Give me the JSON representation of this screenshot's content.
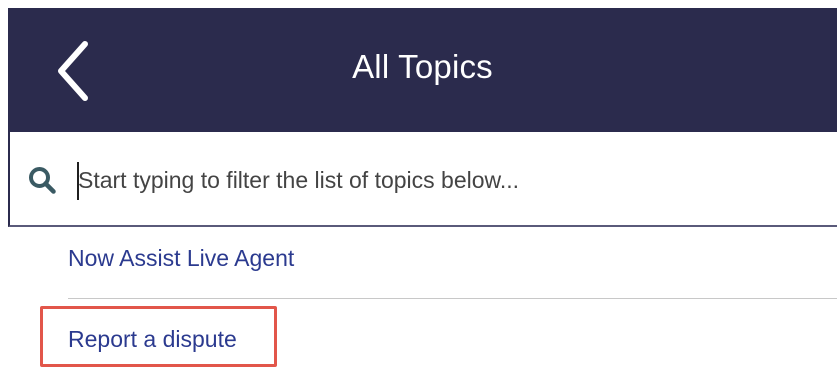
{
  "header": {
    "title": "All Topics",
    "back_icon": "chevron-left-icon",
    "background_color": "#2b2b4d"
  },
  "search": {
    "placeholder": "Start typing to filter the list of topics below...",
    "value": "",
    "icon": "search-icon"
  },
  "topics": {
    "items": [
      {
        "label": "Now Assist Live Agent"
      },
      {
        "label": "Report a dispute",
        "highlighted": true
      }
    ],
    "link_color": "#2b3a8f",
    "highlight_color": "#e2564a"
  }
}
